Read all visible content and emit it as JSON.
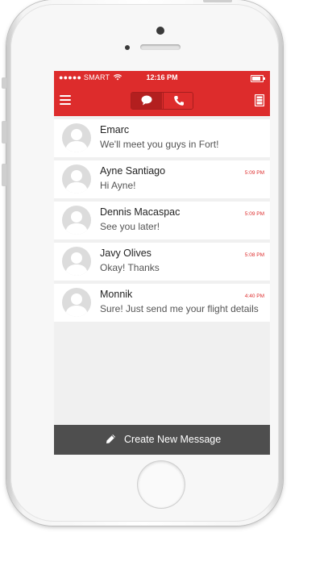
{
  "status_bar": {
    "carrier": "●●●●● SMART",
    "time": "12:16 PM"
  },
  "nav": {
    "menu_icon": "hamburger-menu-icon",
    "tabs": [
      {
        "name": "messages",
        "icon": "chat-bubble-icon",
        "active": true
      },
      {
        "name": "calls",
        "icon": "phone-icon",
        "active": false
      }
    ],
    "contacts_icon": "contacts-book-icon"
  },
  "conversations": [
    {
      "name": "Emarc",
      "preview": "We'll meet you guys in Fort!",
      "time": ""
    },
    {
      "name": "Ayne Santiago",
      "preview": "Hi Ayne!",
      "time": "5:09 PM"
    },
    {
      "name": "Dennis Macaspac",
      "preview": "See you later!",
      "time": "5:09 PM"
    },
    {
      "name": "Javy Olives",
      "preview": "Okay! Thanks",
      "time": "5:08 PM"
    },
    {
      "name": "Monnik",
      "preview": "Sure! Just send me your flight details",
      "time": "4:40 PM"
    }
  ],
  "footer": {
    "create_label": "Create New Message",
    "icon": "pencil-icon"
  },
  "colors": {
    "accent": "#dd2c2c",
    "footer": "#4e4e4e",
    "background": "#f0f0f0"
  }
}
